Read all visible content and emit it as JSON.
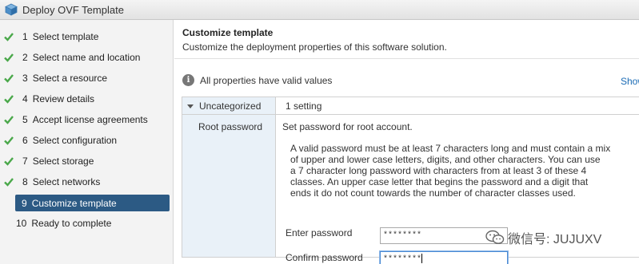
{
  "window": {
    "title": "Deploy OVF Template"
  },
  "steps": [
    {
      "num": "1",
      "label": "Select template",
      "done": true
    },
    {
      "num": "2",
      "label": "Select name and location",
      "done": true
    },
    {
      "num": "3",
      "label": "Select a resource",
      "done": true
    },
    {
      "num": "4",
      "label": "Review details",
      "done": true
    },
    {
      "num": "5",
      "label": "Accept license agreements",
      "done": true
    },
    {
      "num": "6",
      "label": "Select configuration",
      "done": true
    },
    {
      "num": "7",
      "label": "Select storage",
      "done": true
    },
    {
      "num": "8",
      "label": "Select networks",
      "done": true
    },
    {
      "num": "9",
      "label": "Customize template",
      "active": true
    },
    {
      "num": "10",
      "label": "Ready to complete"
    }
  ],
  "main": {
    "title": "Customize template",
    "subtitle": "Customize the deployment properties of this software solution.",
    "info": "All properties have valid values",
    "show_link": "Show"
  },
  "grid": {
    "group_label": "Uncategorized",
    "group_count": "1 setting",
    "prop_label": "Root password",
    "prop_desc": "Set password for root account.",
    "help_lines": [
      "A valid password must be at least 7 characters long and must contain a mix",
      "of upper and lower case letters, digits, and other characters.  You can use",
      "a 7 character long password with characters from at least 3 of these 4",
      "classes.  An upper case letter that begins the password and a digit that",
      "ends it do not count towards the number of character classes used."
    ],
    "enter_label": "Enter password",
    "enter_value": "********",
    "confirm_label": "Confirm password",
    "confirm_value": "********"
  },
  "watermark": {
    "text": "微信号: JUJUXV"
  },
  "colors": {
    "active_step_bg": "#2c5a84",
    "check_green": "#4aa84a",
    "link": "#1a6bb5"
  }
}
